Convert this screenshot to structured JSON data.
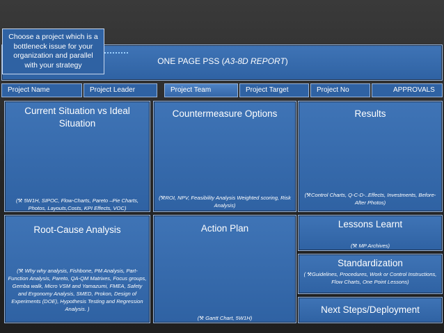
{
  "header": {
    "title_prefix": "ONE PAGE PSS (",
    "title_italic": "A3-8D REPORT",
    "title_suffix": ")"
  },
  "callout": {
    "lines": [
      "Choose a project which is a",
      "bottleneck issue for your",
      "organization and parallel",
      "with your strategy"
    ]
  },
  "tabs": {
    "project_name": "Project Name",
    "project_leader": "Project Leader",
    "project_team": "Project Team",
    "project_target": "Project Target",
    "project_no": "Project No",
    "approvals": "APPROVALS"
  },
  "cards": {
    "current_situation": {
      "title": "Current Situation vs Ideal Situation",
      "note": "5W1H, SIPOC, Flow-Charts, Pareto –Pie Charts, Photos, Layouts,Costs, KPI Effects, VOC)"
    },
    "countermeasure": {
      "title": "Countermeasure Options",
      "note": "ROI, NPV, Feasibility Analysis Weighted scoring, Risk Analysis)"
    },
    "results": {
      "title": "Results",
      "note": "Control Charts, Q-C-D-..Effects, Investments, Before-After Photos)"
    },
    "root_cause": {
      "title": "Root-Cause Analysis",
      "note": "Why why analysis, Fishbone, PM Analysis, Part-Function Analysis, Pareto, QA-QM Matrixes, Focus groups, Gemba walk, Micro VSM and Yamazumi, FMEA, Safety and Ergonomy Analysis, SMED, Prokon, Design of Experiments (DOE), Hypothesis Testing and Regression Analysis. )"
    },
    "action_plan": {
      "title": "Action Plan",
      "note": "Gantt Chart, 5W1H)"
    },
    "lessons_learnt": {
      "title": "Lessons Learnt",
      "note": "MP Archives)"
    },
    "standardization": {
      "title": "Standardization",
      "note": "Guidelines, Procedures, Work or Control Instructions, Flow Charts, One Point Lessons)"
    },
    "next_steps": {
      "title": "Next Steps/Deployment"
    }
  }
}
